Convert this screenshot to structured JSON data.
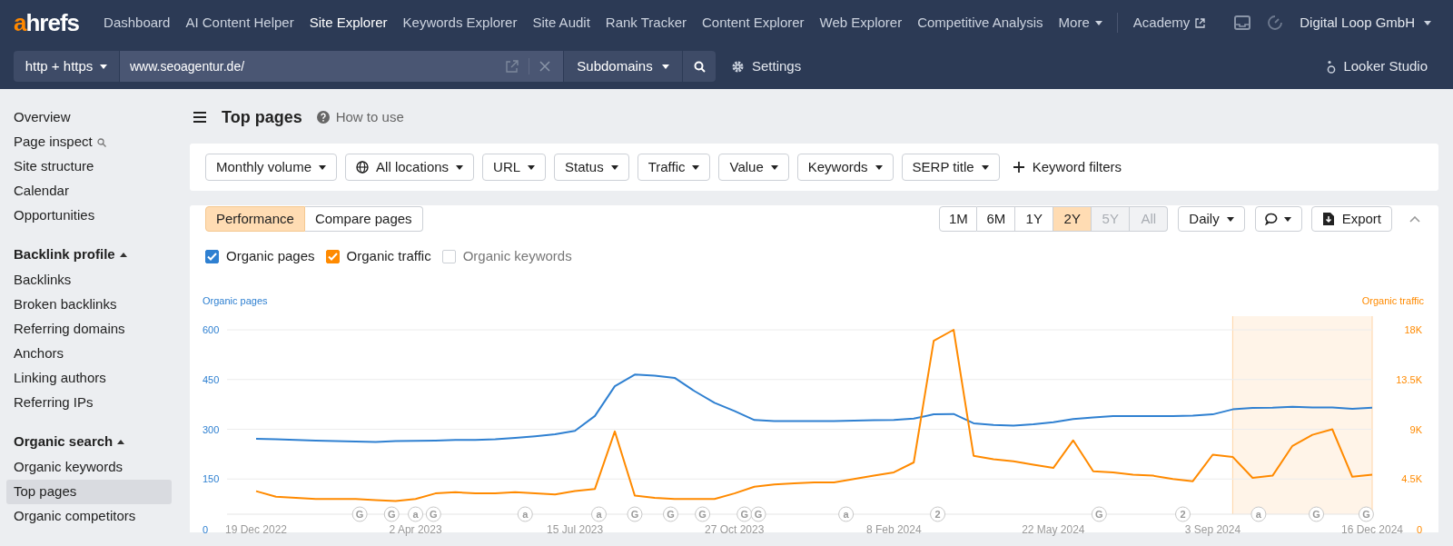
{
  "logo": {
    "accent": "a",
    "rest": "hrefs"
  },
  "nav": {
    "items": [
      {
        "label": "Dashboard",
        "selected": false
      },
      {
        "label": "AI Content Helper",
        "selected": false
      },
      {
        "label": "Site Explorer",
        "selected": true
      },
      {
        "label": "Keywords Explorer",
        "selected": false
      },
      {
        "label": "Site Audit",
        "selected": false
      },
      {
        "label": "Rank Tracker",
        "selected": false
      },
      {
        "label": "Content Explorer",
        "selected": false
      },
      {
        "label": "Web Explorer",
        "selected": false
      },
      {
        "label": "Competitive Analysis",
        "selected": false
      }
    ],
    "more": "More",
    "academy": "Academy",
    "account": "Digital Loop GmbH"
  },
  "search_bar": {
    "protocol": "http + https",
    "url": "www.seoagentur.de/",
    "mode": "Subdomains",
    "settings": "Settings",
    "looker": "Looker Studio"
  },
  "sidebar": {
    "sections": [
      {
        "items": [
          {
            "label": "Overview",
            "selected": false
          },
          {
            "label": "Page inspect",
            "selected": false,
            "kind": "search"
          },
          {
            "label": "Site structure",
            "selected": false
          },
          {
            "label": "Calendar",
            "selected": false
          },
          {
            "label": "Opportunities",
            "selected": false
          }
        ]
      },
      {
        "title": "Backlink profile",
        "expanded": true,
        "items": [
          {
            "label": "Backlinks",
            "selected": false
          },
          {
            "label": "Broken backlinks",
            "selected": false
          },
          {
            "label": "Referring domains",
            "selected": false
          },
          {
            "label": "Anchors",
            "selected": false
          },
          {
            "label": "Linking authors",
            "selected": false
          },
          {
            "label": "Referring IPs",
            "selected": false
          }
        ]
      },
      {
        "title": "Organic search",
        "expanded": true,
        "items": [
          {
            "label": "Organic keywords",
            "selected": false
          },
          {
            "label": "Top pages",
            "selected": true
          },
          {
            "label": "Organic competitors",
            "selected": false
          }
        ]
      }
    ]
  },
  "page": {
    "title": "Top pages",
    "help": "How to use"
  },
  "filters": [
    {
      "label": "Monthly volume",
      "kind": "dropdown"
    },
    {
      "label": "All locations",
      "kind": "globe"
    },
    {
      "label": "URL",
      "kind": "dropdown"
    },
    {
      "label": "Status",
      "kind": "dropdown"
    },
    {
      "label": "Traffic",
      "kind": "dropdown"
    },
    {
      "label": "Value",
      "kind": "dropdown"
    },
    {
      "label": "Keywords",
      "kind": "dropdown"
    },
    {
      "label": "SERP title",
      "kind": "dropdown"
    },
    {
      "label": "Keyword filters",
      "kind": "add"
    }
  ],
  "chart_panel": {
    "tabs": [
      {
        "label": "Performance",
        "selected": true
      },
      {
        "label": "Compare pages",
        "selected": false
      }
    ],
    "ranges": [
      {
        "label": "1M",
        "selected": false,
        "disabled": false
      },
      {
        "label": "6M",
        "selected": false,
        "disabled": false
      },
      {
        "label": "1Y",
        "selected": false,
        "disabled": false
      },
      {
        "label": "2Y",
        "selected": true,
        "disabled": false
      },
      {
        "label": "5Y",
        "selected": false,
        "disabled": true
      },
      {
        "label": "All",
        "selected": false,
        "disabled": true
      }
    ],
    "interval": "Daily",
    "export": "Export",
    "metrics": [
      {
        "label": "Organic pages",
        "checked": true,
        "color": "#2f80d1"
      },
      {
        "label": "Organic traffic",
        "checked": true,
        "color": "#ff8a00"
      },
      {
        "label": "Organic keywords",
        "checked": false
      }
    ],
    "highlight_band": true,
    "events": [
      {
        "text": "G"
      },
      {
        "text": "G"
      },
      {
        "text": "a"
      },
      {
        "text": "G"
      },
      {
        "text": "a"
      },
      {
        "text": "a"
      },
      {
        "text": "G"
      },
      {
        "text": "G"
      },
      {
        "text": "G"
      },
      {
        "text": "G"
      },
      {
        "text": "G"
      },
      {
        "text": "a"
      },
      {
        "text": "2"
      },
      {
        "text": "G"
      },
      {
        "text": "2"
      },
      {
        "text": "a"
      },
      {
        "text": "G"
      },
      {
        "text": "G"
      }
    ],
    "chart_data": {
      "type": "line",
      "grid": true,
      "ylim": [
        0,
        600
      ],
      "y2lim": [
        0,
        18000
      ],
      "categories": [
        "19 Dec 2022",
        null,
        null,
        null,
        null,
        null,
        null,
        null,
        "2 Apr 2023",
        null,
        null,
        null,
        null,
        null,
        null,
        null,
        "15 Jul 2023",
        null,
        null,
        null,
        null,
        null,
        null,
        null,
        "27 Oct 2023",
        null,
        null,
        null,
        null,
        null,
        null,
        null,
        "8 Feb 2024",
        null,
        null,
        null,
        null,
        null,
        null,
        null,
        "22 May 2024",
        null,
        null,
        null,
        null,
        null,
        null,
        null,
        "3 Sep 2024",
        null,
        null,
        null,
        null,
        null,
        null,
        null,
        "16 Dec 2024"
      ],
      "series": [
        {
          "name": "Organic pages",
          "color": "#2f80d1",
          "values": [
            271,
            270,
            268,
            266,
            264,
            263,
            262,
            264,
            265,
            266,
            268,
            268,
            270,
            274,
            279,
            285,
            295,
            340,
            430,
            465,
            462,
            455,
            415,
            380,
            355,
            328,
            325,
            325,
            325,
            325,
            326,
            327,
            328,
            332,
            345,
            346,
            318,
            313,
            311,
            315,
            321,
            331,
            336,
            340,
            340,
            340,
            340,
            341,
            345,
            360,
            364,
            365,
            368,
            366,
            366,
            362,
            365
          ]
        },
        {
          "name": "Organic traffic",
          "color": "#ff8a00",
          "axis": "y2",
          "values": [
            3400,
            2900,
            2800,
            2700,
            2700,
            2700,
            2600,
            2500,
            2700,
            3200,
            3300,
            3200,
            3200,
            3300,
            3200,
            3100,
            3400,
            3600,
            8800,
            3000,
            2800,
            2700,
            2700,
            2700,
            3200,
            3800,
            4000,
            4100,
            4200,
            4200,
            4500,
            4800,
            5100,
            6000,
            17000,
            18000,
            6600,
            6300,
            6100,
            5800,
            5500,
            8000,
            5200,
            5100,
            4900,
            4800,
            4500,
            4300,
            6700,
            6500,
            4600,
            4800,
            7500,
            8500,
            9000,
            4700,
            4900
          ]
        }
      ],
      "yticks": [
        0,
        150,
        300,
        450,
        600
      ],
      "y2ticks": [
        {
          "value": 0,
          "label": "0"
        },
        {
          "value": 4500,
          "label": "4.5K"
        },
        {
          "value": 9000,
          "label": "9K"
        },
        {
          "value": 13500,
          "label": "13.5K"
        },
        {
          "value": 18000,
          "label": "18K"
        }
      ]
    }
  }
}
